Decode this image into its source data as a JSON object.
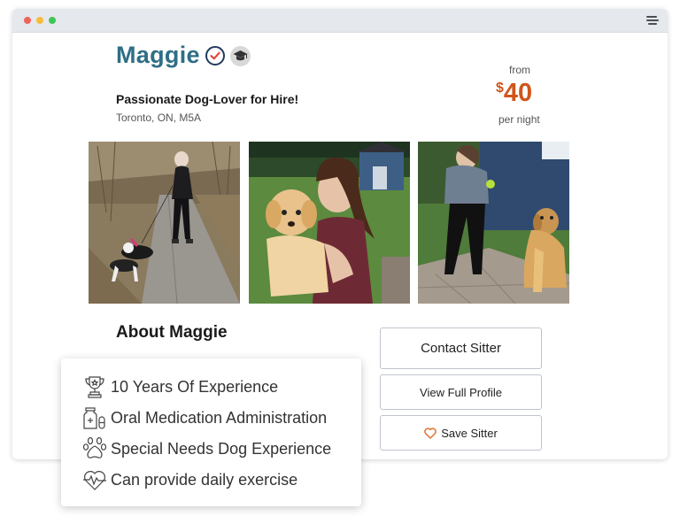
{
  "window": {
    "controls": [
      "close",
      "minimize",
      "maximize"
    ],
    "menu_icon": "menu-icon"
  },
  "profile": {
    "name": "Maggie",
    "tagline": "Passionate Dog-Lover for Hire!",
    "location": "Toronto, ON, M5A",
    "badges": [
      "verified-check-icon",
      "graduation-cap-icon"
    ]
  },
  "pricing": {
    "from_label": "from",
    "currency": "$",
    "amount": "40",
    "unit": "per night"
  },
  "photos": [
    {
      "alt": "woman walking two dogs on path"
    },
    {
      "alt": "woman holding golden retriever puppy"
    },
    {
      "alt": "woman playing with golden retriever in yard"
    }
  ],
  "about": {
    "title": "About Maggie"
  },
  "actions": {
    "contact": "Contact Sitter",
    "profile": "View Full Profile",
    "save": "Save Sitter"
  },
  "features": [
    {
      "icon": "trophy-icon",
      "label": "10 Years Of Experience"
    },
    {
      "icon": "medication-icon",
      "label": "Oral Medication Administration"
    },
    {
      "icon": "paw-icon",
      "label": "Special Needs Dog Experience"
    },
    {
      "icon": "heart-pulse-icon",
      "label": "Can provide daily exercise"
    }
  ],
  "colors": {
    "name": "#2f6e86",
    "price": "#d0561a",
    "heart": "#e0722c",
    "titlebar": "#e5e8ed"
  }
}
